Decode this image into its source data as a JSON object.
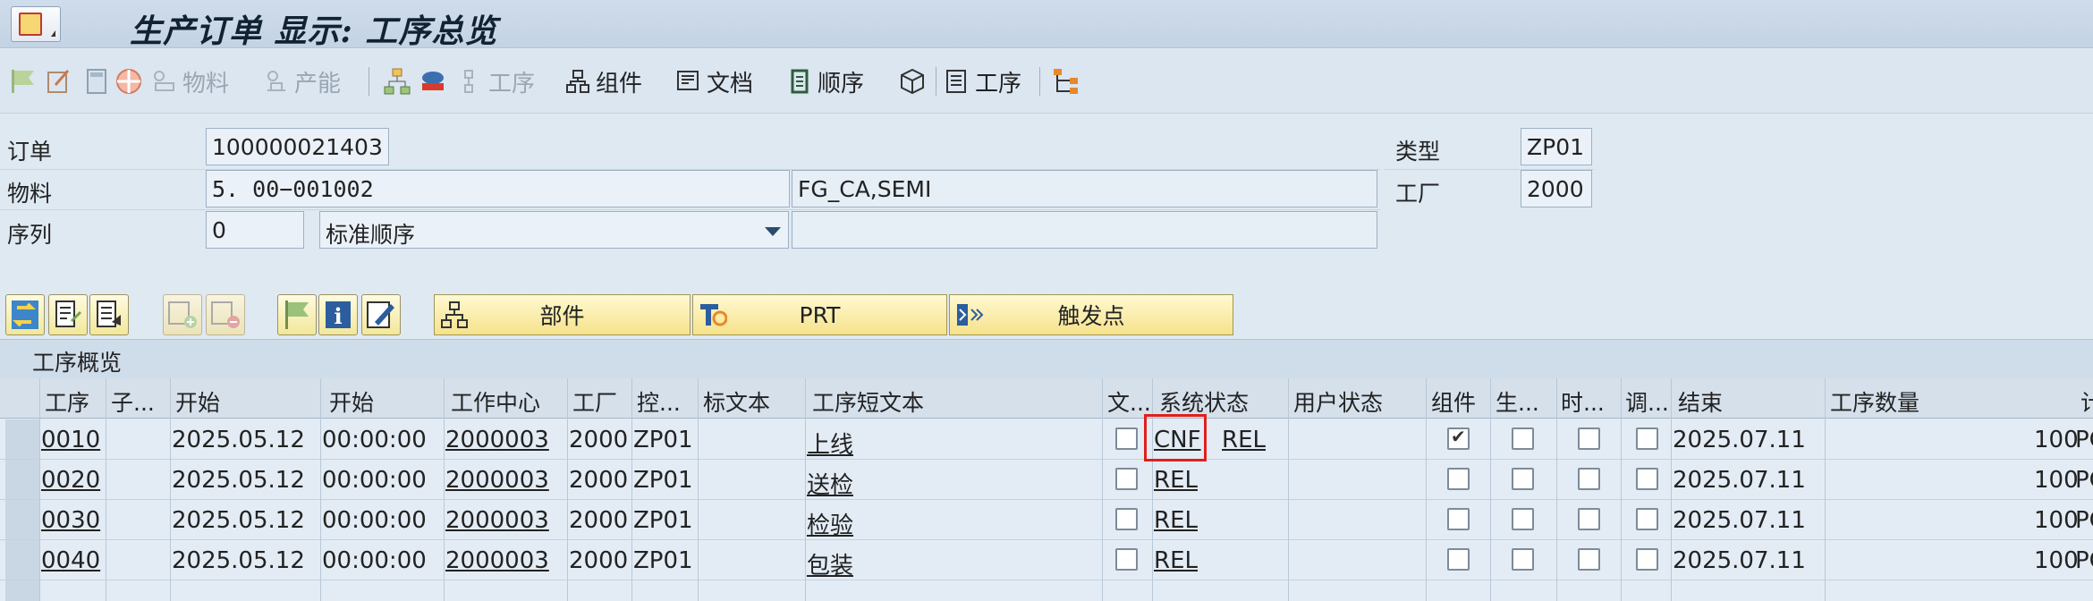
{
  "window": {
    "title": "生产订单 显示: 工序总览"
  },
  "toolbar": {
    "items": [
      {
        "label": "物料",
        "enabled": false,
        "icon": "material-icon"
      },
      {
        "label": "产能",
        "enabled": false,
        "icon": "capacity-icon"
      },
      {
        "label": "工序",
        "enabled": false,
        "icon": "operation-icon"
      },
      {
        "label": "组件",
        "enabled": true,
        "icon": "component-icon"
      },
      {
        "label": "文档",
        "enabled": true,
        "icon": "document-icon"
      },
      {
        "label": "顺序",
        "enabled": true,
        "icon": "sequence-icon"
      },
      {
        "label": "工序",
        "enabled": true,
        "icon": "operation-list-icon"
      }
    ]
  },
  "header": {
    "order_label": "订单",
    "order_value": "100000021403",
    "material_label": "物料",
    "material_value": "5. 00−001002",
    "material_desc": "FG_CA,SEMI",
    "sequence_label": "序列",
    "sequence_value": "0",
    "sequence_select": "标准顺序",
    "sequence_desc": "",
    "type_label": "类型",
    "type_value": "ZP01",
    "plant_label": "工厂",
    "plant_value": "2000"
  },
  "buttons": {
    "component": "部件",
    "prt": "PRT",
    "trigger": "触发点"
  },
  "table": {
    "title": "工序概览",
    "columns": [
      "工序",
      "子...",
      "开始",
      "开始",
      "工作中心",
      "工厂",
      "控...",
      "标文本",
      "工序短文本",
      "文...",
      "系统状态",
      "用户状态",
      "组件",
      "生...",
      "时...",
      "调...",
      "结束",
      "工序数量",
      "计"
    ],
    "rows": [
      {
        "op": "0010",
        "start_date": "2025.05.12",
        "start_time": "00:00:00",
        "wc": "2000003",
        "plant": "2000",
        "ctrl": "ZP01",
        "text": "上线",
        "status1": "CNF",
        "status2": "REL",
        "component": true,
        "end": "2025.07.11",
        "qty": "100",
        "unit": "PC"
      },
      {
        "op": "0020",
        "start_date": "2025.05.12",
        "start_time": "00:00:00",
        "wc": "2000003",
        "plant": "2000",
        "ctrl": "ZP01",
        "text": "送检",
        "status1": "REL",
        "status2": "",
        "component": false,
        "end": "2025.07.11",
        "qty": "100",
        "unit": "PC"
      },
      {
        "op": "0030",
        "start_date": "2025.05.12",
        "start_time": "00:00:00",
        "wc": "2000003",
        "plant": "2000",
        "ctrl": "ZP01",
        "text": "检验",
        "status1": "REL",
        "status2": "",
        "component": false,
        "end": "2025.07.11",
        "qty": "100",
        "unit": "PC"
      },
      {
        "op": "0040",
        "start_date": "2025.05.12",
        "start_time": "00:00:00",
        "wc": "2000003",
        "plant": "2000",
        "ctrl": "ZP01",
        "text": "包装",
        "status1": "REL",
        "status2": "",
        "component": false,
        "end": "2025.07.11",
        "qty": "100",
        "unit": "PC"
      }
    ]
  },
  "colors": {
    "highlight": "#e0201a",
    "button_yellow": "#f6e28b",
    "background": "#dfe9f2"
  }
}
